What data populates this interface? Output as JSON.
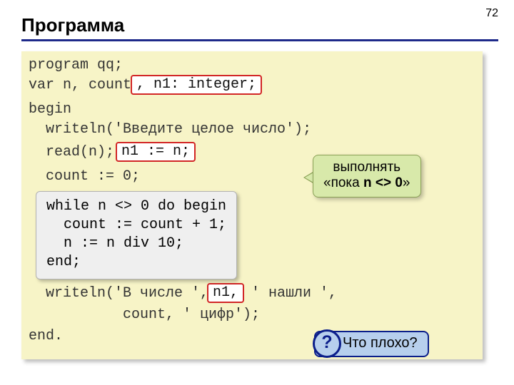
{
  "page_number": "72",
  "title": "Программа",
  "code": {
    "l1": "program qq;",
    "l2": "var n, count",
    "l3": "begin",
    "l4": "  writeln('Введите целое число');",
    "l5": "  read(n);",
    "l6": "  count := 0;",
    "l7a": "  writeln('В числе ',",
    "l7b": " ' нашли ',",
    "l8": "           count, ' цифр');",
    "l9": "end."
  },
  "highlights": {
    "h1": ", n1: integer;",
    "h2": "n1 := n;",
    "h3": "n1,"
  },
  "loop_box": "while n <> 0 do begin\n  count := count + 1;\n  n := n div 10;\nend;",
  "note": {
    "line1": "выполнять",
    "line2_prefix": "«пока ",
    "line2_bold": "n <> 0",
    "line2_suffix": "»"
  },
  "question_label": "Что плохо?",
  "question_mark": "?"
}
